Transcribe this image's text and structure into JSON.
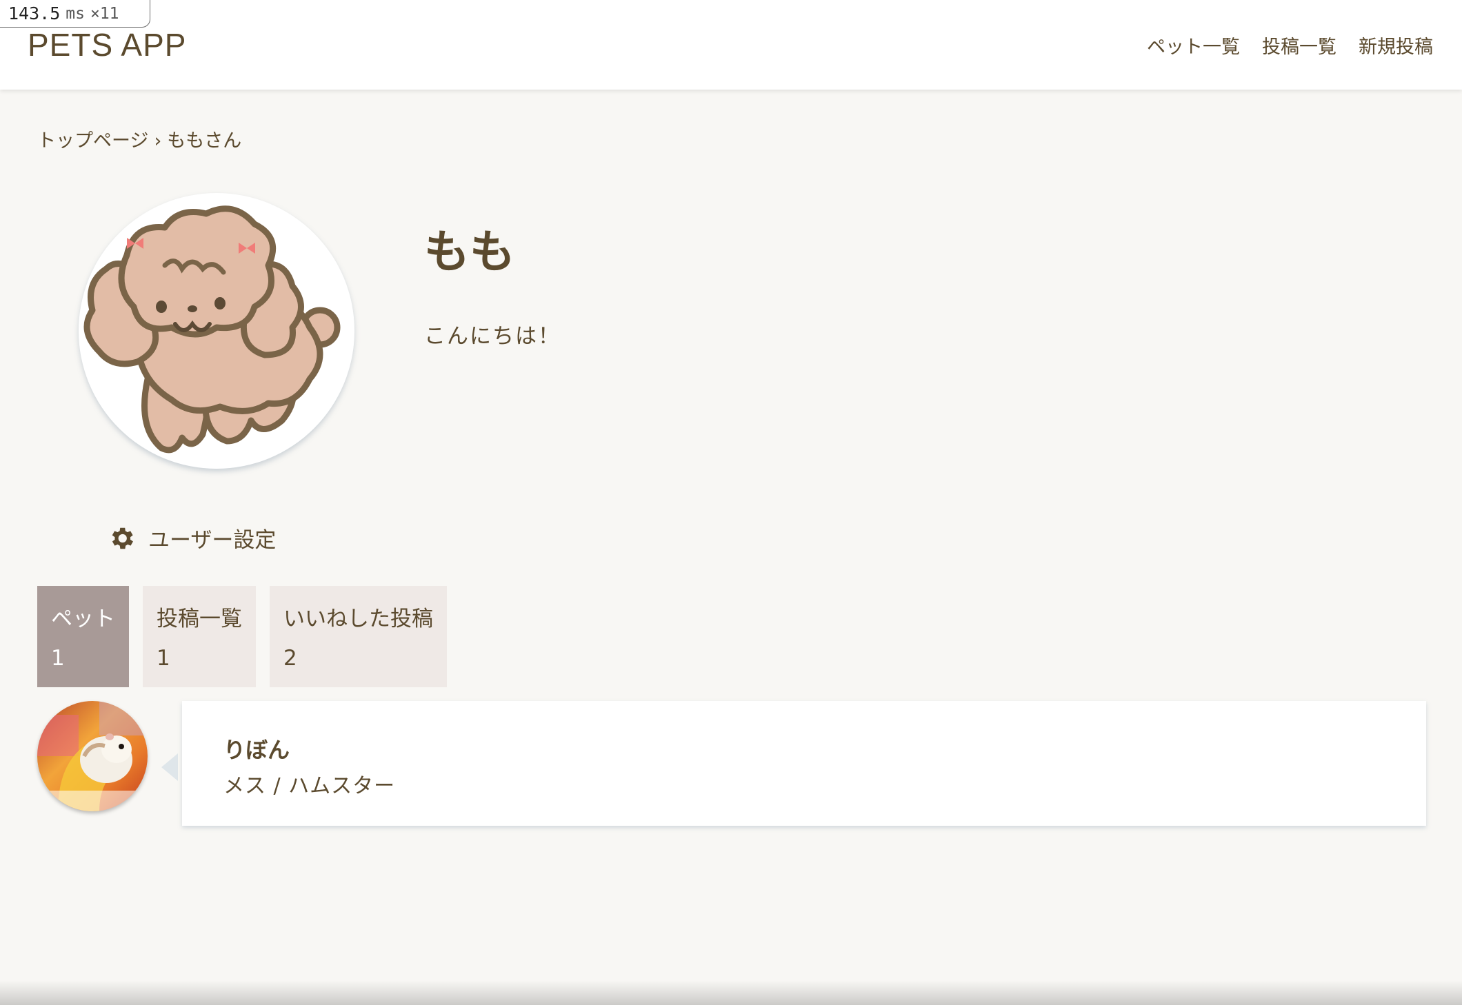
{
  "perf": {
    "value": "143.5",
    "unit": "ms",
    "count": "×11"
  },
  "header": {
    "logo": "PETS APP",
    "nav": [
      "ペット一覧",
      "投稿一覧",
      "新規投稿"
    ]
  },
  "breadcrumb": {
    "home": "トップページ",
    "separator": "›",
    "current": "ももさん"
  },
  "profile": {
    "avatar_icon": "poodle-illustration",
    "name": "もも",
    "greeting": "こんにちは！"
  },
  "settings": {
    "icon": "gear-icon",
    "label": "ユーザー設定"
  },
  "tabs": [
    {
      "label": "ペット",
      "count": "1",
      "active": true
    },
    {
      "label": "投稿一覧",
      "count": "1",
      "active": false
    },
    {
      "label": "いいねした投稿",
      "count": "2",
      "active": false
    }
  ],
  "pets": [
    {
      "photo": "hamster-photo",
      "name": "りぼん",
      "meta": "メス / ハムスター"
    }
  ],
  "colors": {
    "text": "#5b4a2e",
    "background": "#f8f7f4",
    "tab_active": "#a89a97",
    "tab_inactive": "#efe9e6"
  }
}
